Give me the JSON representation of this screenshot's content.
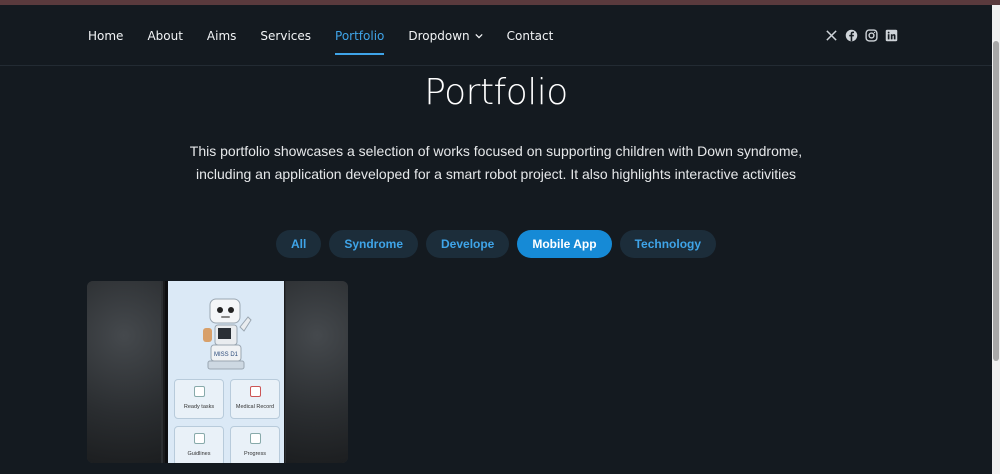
{
  "nav": {
    "items": [
      {
        "label": "Home"
      },
      {
        "label": "About"
      },
      {
        "label": "Aims"
      },
      {
        "label": "Services"
      },
      {
        "label": "Portfolio",
        "active": true
      },
      {
        "label": "Dropdown"
      },
      {
        "label": "Contact"
      }
    ],
    "social": [
      "x-icon",
      "facebook-icon",
      "instagram-icon",
      "linkedin-icon"
    ]
  },
  "page": {
    "title": "Portfolio",
    "description": "This portfolio showcases a selection of works focused on supporting children with Down syndrome, including an application developed for a smart robot project. It also highlights interactive activities"
  },
  "filters": [
    {
      "label": "All"
    },
    {
      "label": "Syndrome"
    },
    {
      "label": "Develope"
    },
    {
      "label": "Mobile App",
      "active": true
    },
    {
      "label": "Technology"
    }
  ],
  "card": {
    "robot_label": "MISS D1",
    "tiles": [
      {
        "label": "Ready tasks"
      },
      {
        "label": "Medical Record"
      },
      {
        "label": "Guidlines"
      },
      {
        "label": "Progress"
      }
    ]
  },
  "colors": {
    "background": "#141a20",
    "accent": "#3fa4e8",
    "active_filter": "#168ad6",
    "filter_bg": "#1c2d3a"
  }
}
